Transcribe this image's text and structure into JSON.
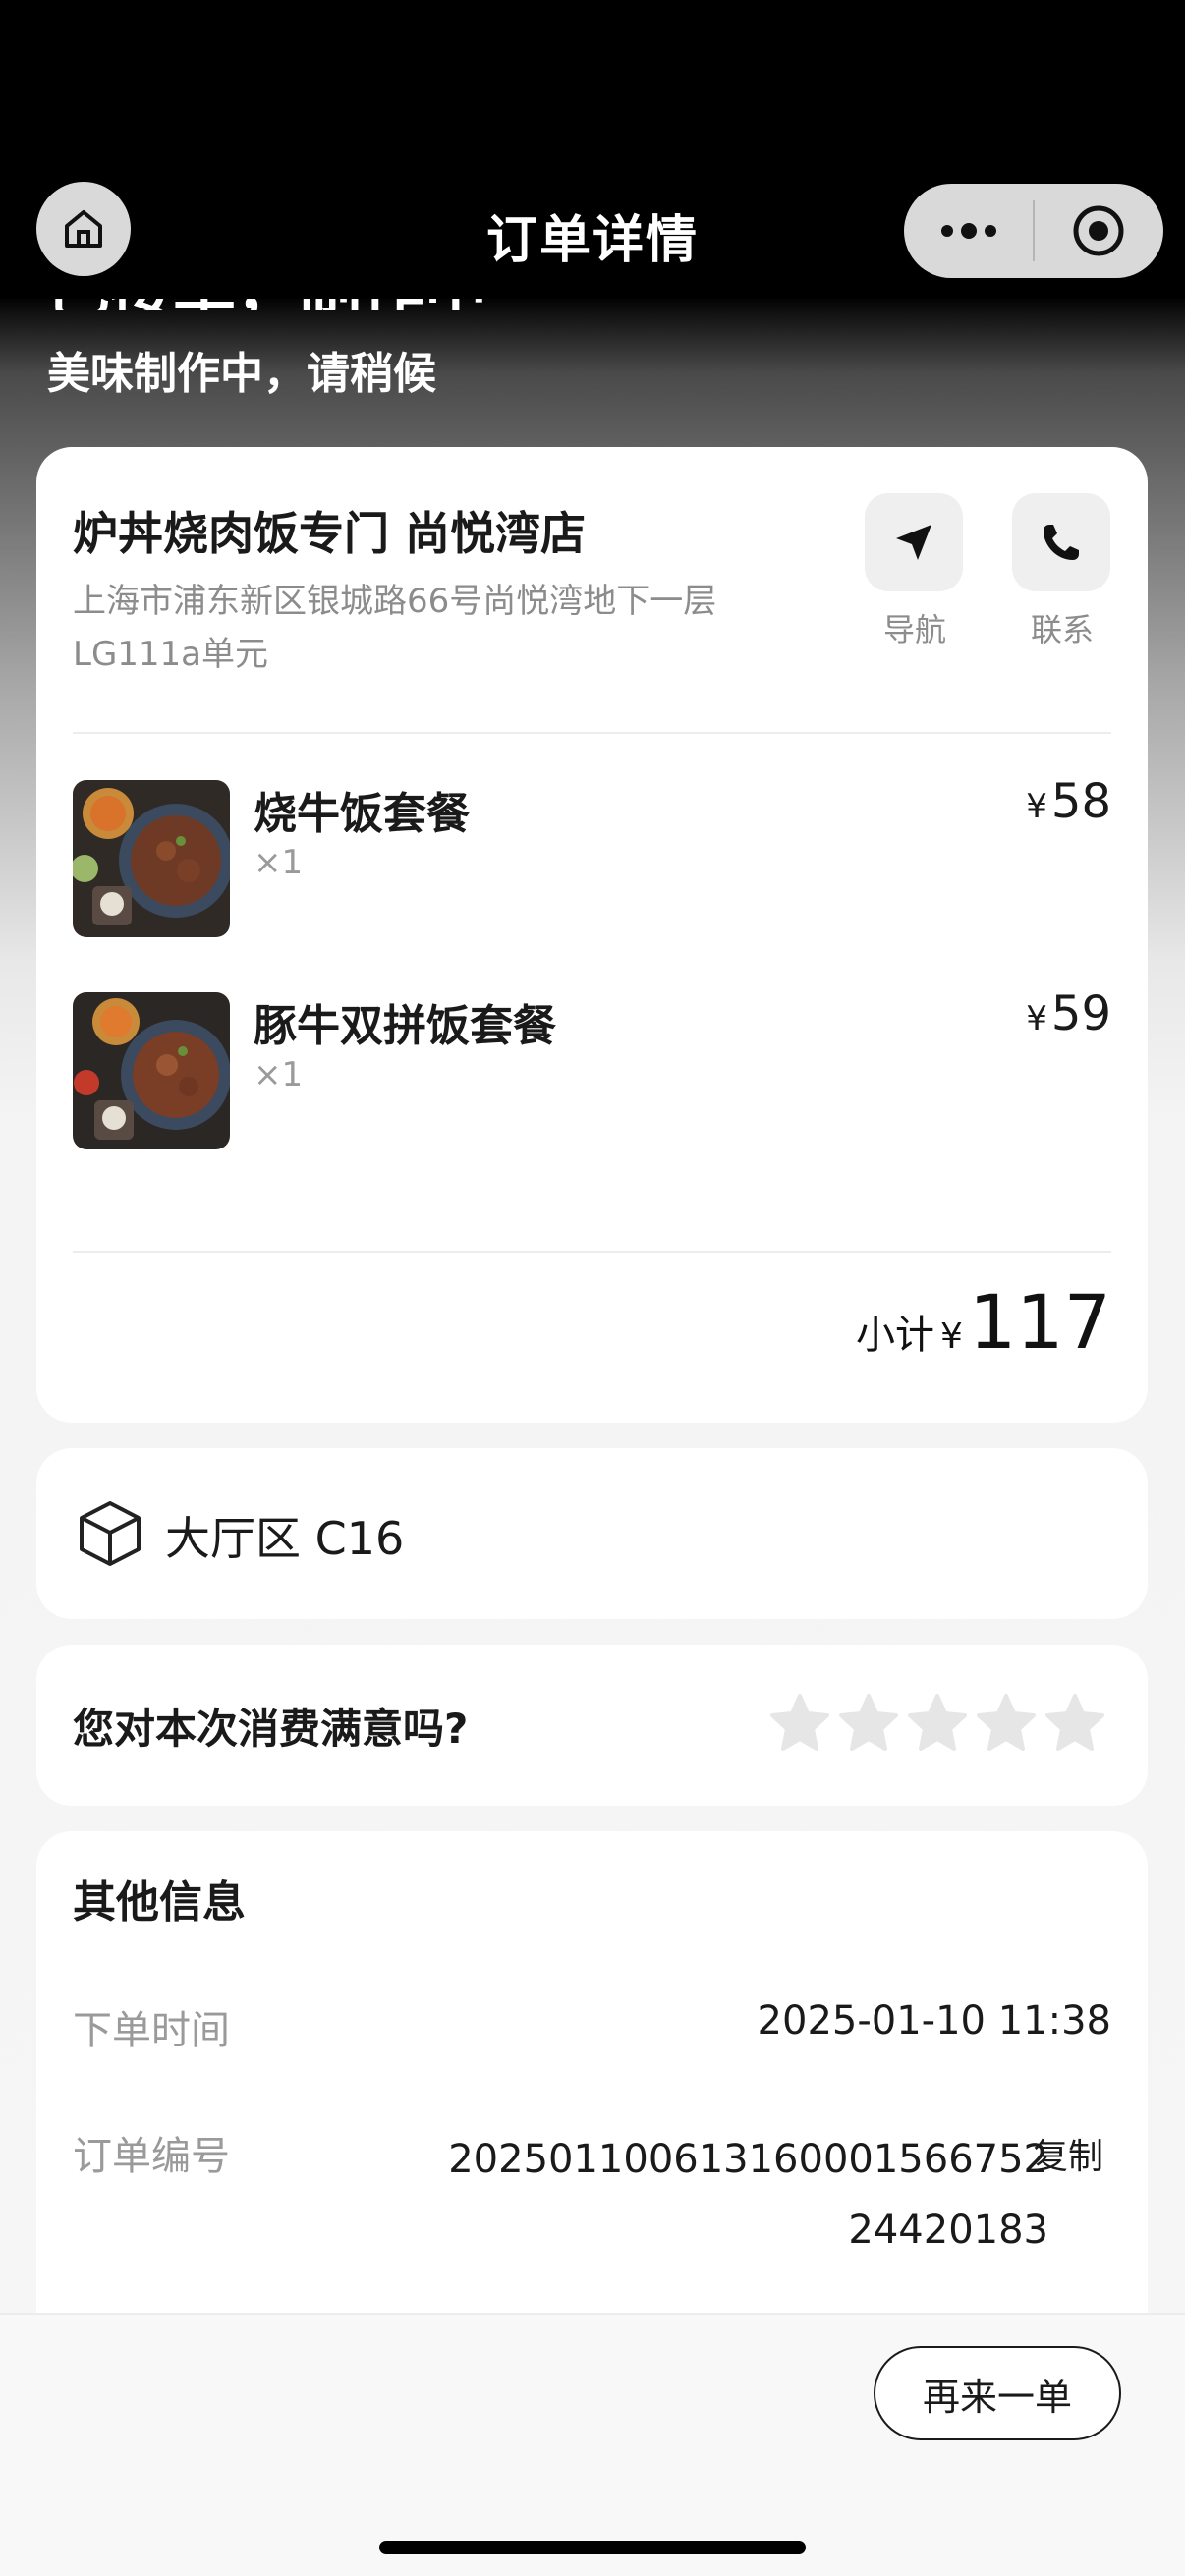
{
  "nav": {
    "title": "订单详情",
    "home_icon": "home-icon",
    "more_icon": "more-dots-icon",
    "close_icon": "target-close-icon"
  },
  "status": {
    "heading_partial": "已接单，制作中",
    "subtitle": "美味制作中，请稍候"
  },
  "store": {
    "name": "炉丼烧肉饭专门 尚悦湾店",
    "address": "上海市浦东新区银城路66号尚悦湾地下一层LG111a单元",
    "navigate_label": "导航",
    "contact_label": "联系"
  },
  "items": [
    {
      "name": "烧牛饭套餐",
      "qty": "×1",
      "currency": "¥",
      "price": "58"
    },
    {
      "name": "豚牛双拼饭套餐",
      "qty": "×1",
      "currency": "¥",
      "price": "59"
    }
  ],
  "subtotal": {
    "label": "小计",
    "currency": "¥",
    "amount": "117"
  },
  "table": {
    "text": "大厅区 C16",
    "icon": "package-box-icon"
  },
  "rating": {
    "question": "您对本次消费满意吗?",
    "stars": 5,
    "selected": 0
  },
  "other_info": {
    "title": "其他信息",
    "order_time_label": "下单时间",
    "order_time": "2025-01-10 11:38",
    "order_no_label": "订单编号",
    "order_no": "20250110061316000156675224420183",
    "copy_label": "复制"
  },
  "bottom": {
    "reorder_label": "再来一单"
  },
  "colors": {
    "accent": "#000000",
    "card": "#ffffff",
    "muted": "#9a9a9a"
  }
}
